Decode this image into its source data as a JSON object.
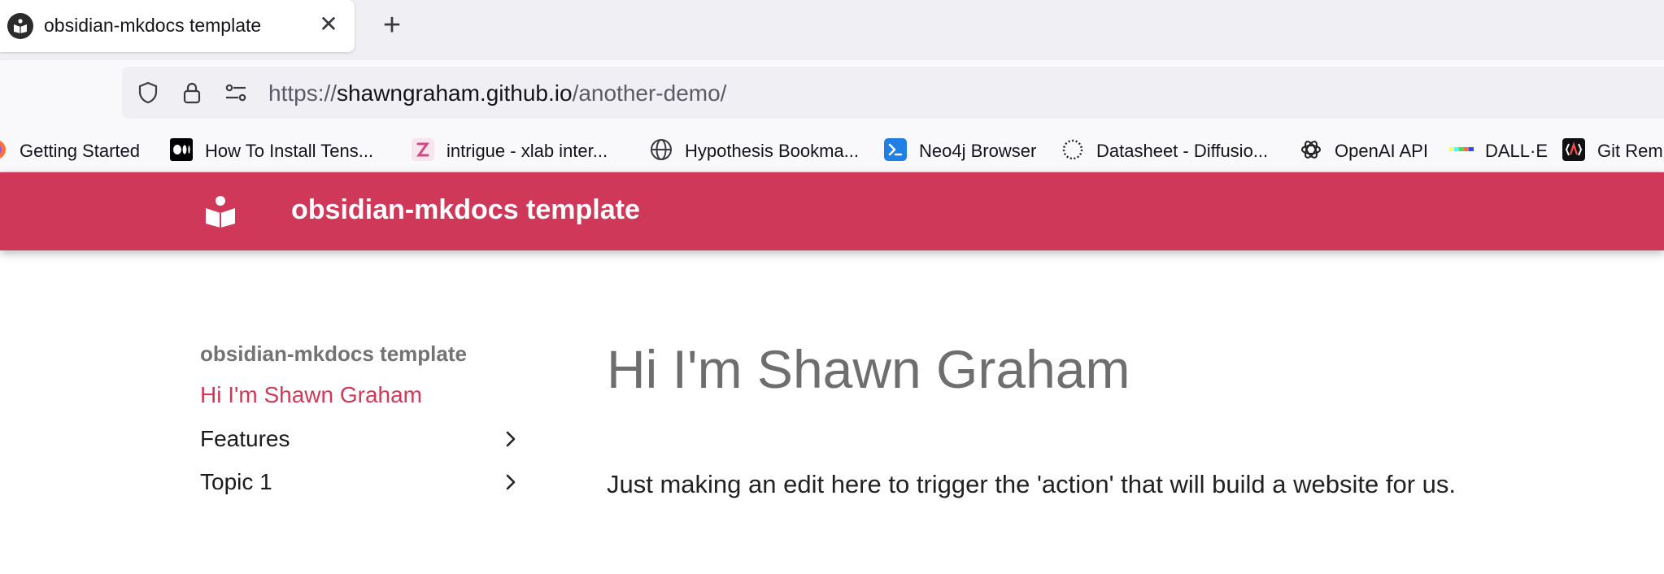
{
  "browser": {
    "tab": {
      "title": "obsidian-mkdocs template",
      "close_glyph": "✕",
      "favicon": "book-open-icon"
    },
    "new_tab_glyph": "+",
    "address_bar": {
      "scheme": "https://",
      "host": "shawngraham.github.io",
      "path": "/another-demo/",
      "icons": [
        "shield-icon",
        "lock-icon",
        "page-settings-icon"
      ]
    },
    "bookmarks": [
      {
        "label": "Getting Started",
        "icon": "firefox-icon"
      },
      {
        "label": "How To Install Tens...",
        "icon": "medium-icon"
      },
      {
        "label": "intrigue - xlab inter...",
        "icon": "intrigue-icon"
      },
      {
        "label": "Hypothesis Bookma...",
        "icon": "globe-icon"
      },
      {
        "label": "Neo4j Browser",
        "icon": "terminal-icon"
      },
      {
        "label": "Datasheet - Diffusio...",
        "icon": "dotted-circle-icon"
      },
      {
        "label": "OpenAI API",
        "icon": "openai-icon"
      },
      {
        "label": "DALL·E",
        "icon": "dalle-icon"
      },
      {
        "label": "Git Rem",
        "icon": "git-icon"
      }
    ]
  },
  "site": {
    "header_title": "obsidian-mkdocs template",
    "brand_color": "#cf3858",
    "logo": "book-open-icon"
  },
  "sidebar": {
    "title": "obsidian-mkdocs template",
    "items": [
      {
        "label": "Hi I'm Shawn Graham",
        "active": true
      },
      {
        "label": "Features",
        "expandable": true
      },
      {
        "label": "Topic 1",
        "expandable": true
      }
    ]
  },
  "content": {
    "title": "Hi I'm Shawn Graham",
    "body": "Just making an edit here to trigger the 'action' that will build a website for us."
  }
}
